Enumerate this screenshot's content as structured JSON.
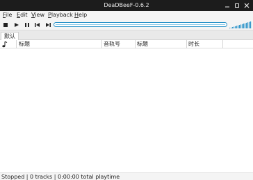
{
  "window": {
    "title": "DeaDBeeF-0.6.2"
  },
  "menubar": {
    "file": {
      "mnemonic": "F",
      "rest": "ile"
    },
    "edit": {
      "mnemonic": "E",
      "rest": "dit"
    },
    "view": {
      "mnemonic": "V",
      "rest": "iew"
    },
    "playback": {
      "mnemonic": "P",
      "rest": "layback"
    },
    "help": {
      "mnemonic": "H",
      "rest": "elp"
    }
  },
  "toolbar": {
    "icons": [
      "stop-icon",
      "play-icon",
      "pause-icon",
      "previous-icon",
      "next-icon"
    ],
    "seek_position": 0,
    "volume_level": 1.0
  },
  "tabs": [
    {
      "label": "默认"
    }
  ],
  "playlist": {
    "columns": [
      {
        "label": "",
        "icon": "music-note-icon"
      },
      {
        "label": "标题"
      },
      {
        "label": "音轨号"
      },
      {
        "label": "标题"
      },
      {
        "label": "时长"
      }
    ],
    "rows": []
  },
  "status": {
    "text": "Stopped | 0 tracks | 0:00:00 total playtime"
  },
  "colors": {
    "titlebar": "#1c1c1c",
    "accent": "#2a93c9",
    "menubar": "#f4f4f4"
  }
}
